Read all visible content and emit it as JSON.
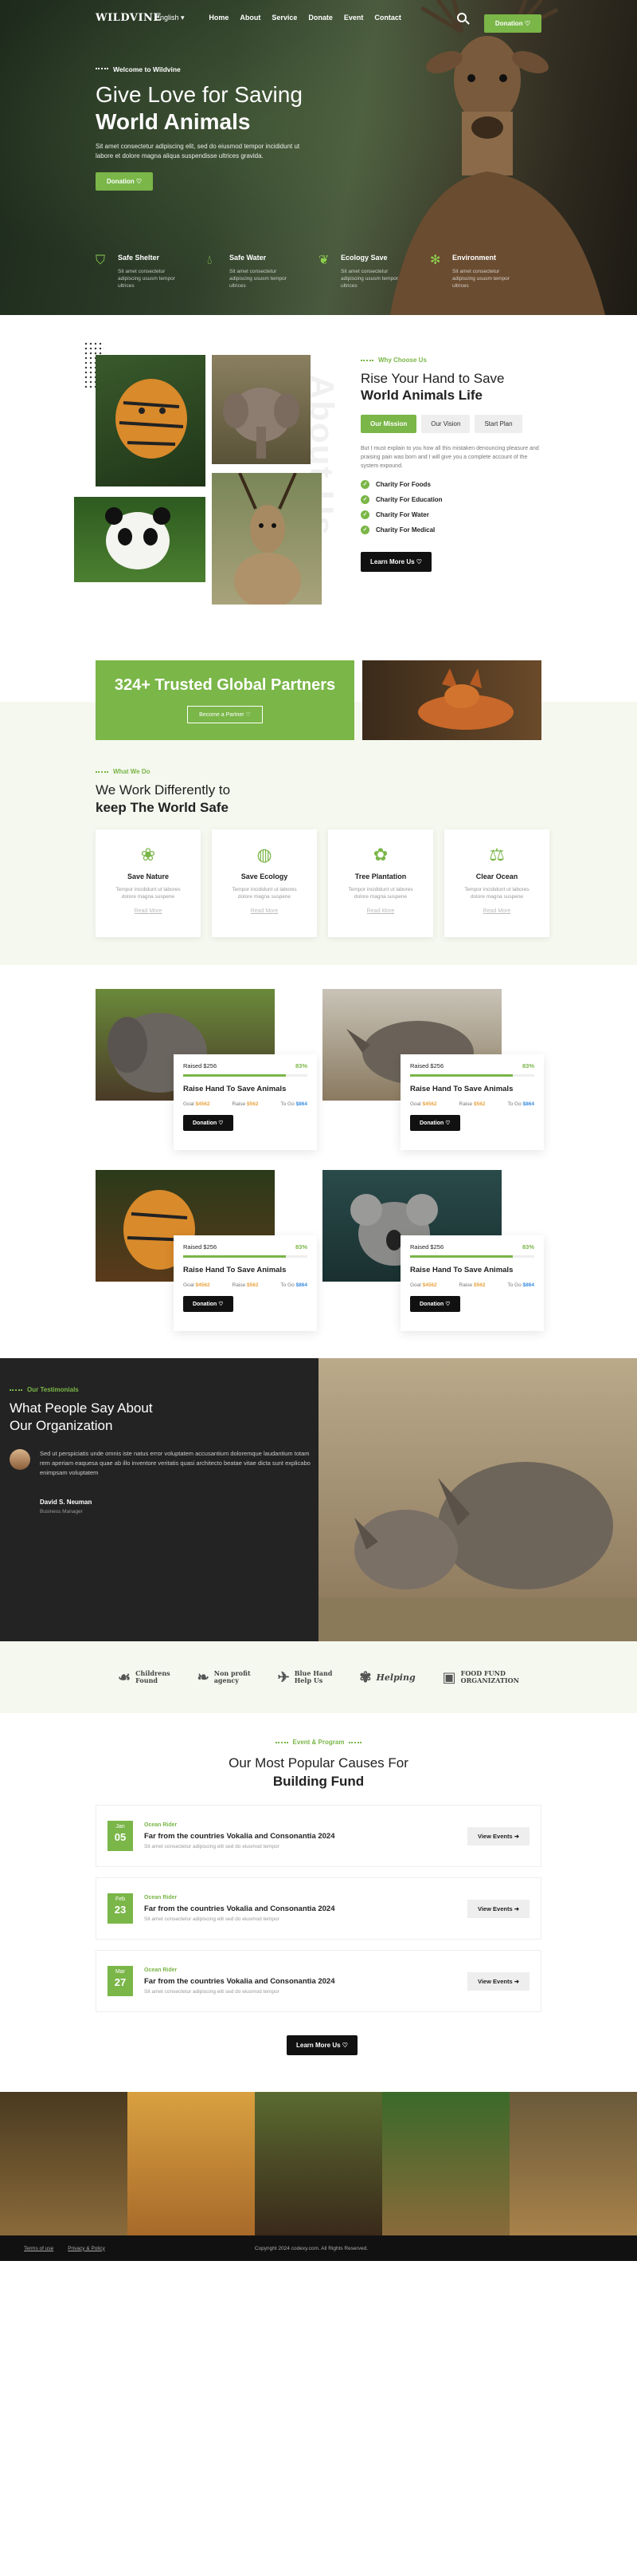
{
  "nav": {
    "logo": "WILDVINE",
    "language": "English",
    "menu": [
      "Home",
      "About",
      "Service",
      "Donate",
      "Event",
      "Contact"
    ],
    "donation_button": "Donation"
  },
  "hero": {
    "eyebrow": "Welcome to Wildvine",
    "title_line1": "Give Love for Saving",
    "title_line2": "World Animals",
    "text": "Sit amet consectetur adipiscing elit, sed do eiusmod tempor incididunt ut labore et dolore magna aliqua suspendisse ultrices gravida.",
    "button": "Donation",
    "features": [
      {
        "title": "Safe Shelter",
        "text": "Sit amet consectetur adipiscing ususm tempor ultrices"
      },
      {
        "title": "Safe Water",
        "text": "Sit amet consectetur adipiscing ususm tempor ultrices"
      },
      {
        "title": "Ecology Save",
        "text": "Sit amet consectetur adipiscing ususm tempor ultrices"
      },
      {
        "title": "Environment",
        "text": "Sit amet consectetur adipiscing ususm tempor ultrices"
      }
    ]
  },
  "about": {
    "vertical_word": "About Us",
    "eyebrow": "Why Choose Us",
    "title_line1": "Rise Your Hand to Save",
    "title_line2": "World Animals Life",
    "tabs": [
      "Our Mission",
      "Our Vision",
      "Start Plan"
    ],
    "text": "But I must explain to you how all this mistaken denouncing pleasure and praising pain was born and I will give you a complete account of the system expound.",
    "checks": [
      "Charity For Foods",
      "Charity For Education",
      "Charity For Water",
      "Charity For Medical"
    ],
    "button": "Learn More Us"
  },
  "partners": {
    "title": "324+ Trusted Global Partners",
    "button": "Become a Partner"
  },
  "work": {
    "eyebrow": "What We Do",
    "title_line1": "We Work Differently to",
    "title_line2": "keep The World Safe",
    "cards": [
      {
        "title": "Save Nature",
        "text": "Tempor incididunt ut labores dolore magna suspene",
        "link": "Read More"
      },
      {
        "title": "Save Ecology",
        "text": "Tempor incididunt ut labores dolore magna suspene",
        "link": "Read More"
      },
      {
        "title": "Tree Plantation",
        "text": "Tempor incididunt ut labores dolore magna suspene",
        "link": "Read More"
      },
      {
        "title": "Clear Ocean",
        "text": "Tempor incididunt ut labores dolore magna suspene",
        "link": "Read More"
      }
    ]
  },
  "donations": [
    {
      "raised": "Raised $256",
      "percent": "83%",
      "progress": 0.83,
      "title": "Raise Hand To Save Animals",
      "goal_label": "Goal",
      "goal": "$4562",
      "raise_label": "Raise",
      "raise": "$562",
      "todo_label": "To Go",
      "todo": "$864",
      "button": "Donation"
    },
    {
      "raised": "Raised $256",
      "percent": "83%",
      "progress": 0.83,
      "title": "Raise Hand To Save Animals",
      "goal_label": "Goal",
      "goal": "$4562",
      "raise_label": "Raise",
      "raise": "$562",
      "todo_label": "To Go",
      "todo": "$864",
      "button": "Donation"
    },
    {
      "raised": "Raised $256",
      "percent": "83%",
      "progress": 0.83,
      "title": "Raise Hand To Save Animals",
      "goal_label": "Goal",
      "goal": "$4562",
      "raise_label": "Raise",
      "raise": "$562",
      "todo_label": "To Go",
      "todo": "$864",
      "button": "Donation"
    },
    {
      "raised": "Raised $256",
      "percent": "83%",
      "progress": 0.83,
      "title": "Raise Hand To Save Animals",
      "goal_label": "Goal",
      "goal": "$4562",
      "raise_label": "Raise",
      "raise": "$562",
      "todo_label": "To Go",
      "todo": "$864",
      "button": "Donation"
    }
  ],
  "testimonial": {
    "eyebrow": "Our Testimonials",
    "title_line1": "What People Say About",
    "title_line2": "Our Organization",
    "quote": "Sed ut perspiciatis unde omnis iste natus error voluptatem accusantium doloremque laudantium totam rem aperiam eaquesa quae ab illo inventore veritatis quasi architecto beatae vitae dicta sunt explicabo enimpsam voluptatem",
    "name": "David S. Neuman",
    "role": "Business Manager"
  },
  "logos": [
    {
      "icon": "hand-heart-icon",
      "line1": "Childrens",
      "line2": "Found"
    },
    {
      "icon": "leaf-icon",
      "line1": "Non profit",
      "line2": "agency"
    },
    {
      "icon": "dove-icon",
      "line1": "Blue Hand",
      "line2": "Help Us"
    },
    {
      "icon": "plant-icon",
      "line1": "Helping",
      "line2": ""
    },
    {
      "icon": "box-icon",
      "line1": "FOOD FUND",
      "line2": "ORGANIZATION"
    }
  ],
  "events": {
    "eyebrow": "Event & Program",
    "title_line1": "Our Most Popular Causes For",
    "title_line2": "Building Fund",
    "items": [
      {
        "month": "Jan",
        "day": "05",
        "category": "Ocean Rider",
        "title": "Far from the countries Vokalia and Consonantia 2024",
        "text": "Sit amet consectetur adipiscing elit sed do eiusmod tempor",
        "button": "View Events"
      },
      {
        "month": "Feb",
        "day": "23",
        "category": "Ocean Rider",
        "title": "Far from the countries Vokalia and Consonantia 2024",
        "text": "Sit amet consectetur adipiscing elit sed do eiusmod tempor",
        "button": "View Events"
      },
      {
        "month": "Mar",
        "day": "27",
        "category": "Ocean Rider",
        "title": "Far from the countries Vokalia and Consonantia 2024",
        "text": "Sit amet consectetur adipiscing elit sed do eiusmod tempor",
        "button": "View Events"
      }
    ],
    "button": "Learn More Us"
  },
  "footer": {
    "terms": "Terms of use",
    "privacy": "Privacy & Policy",
    "copyright": "Copyright 2024 codexy.com. All Rights Reserved."
  },
  "colors": {
    "accent": "#7ab648",
    "dark": "#232323",
    "bg_soft": "#f5f8ef"
  }
}
